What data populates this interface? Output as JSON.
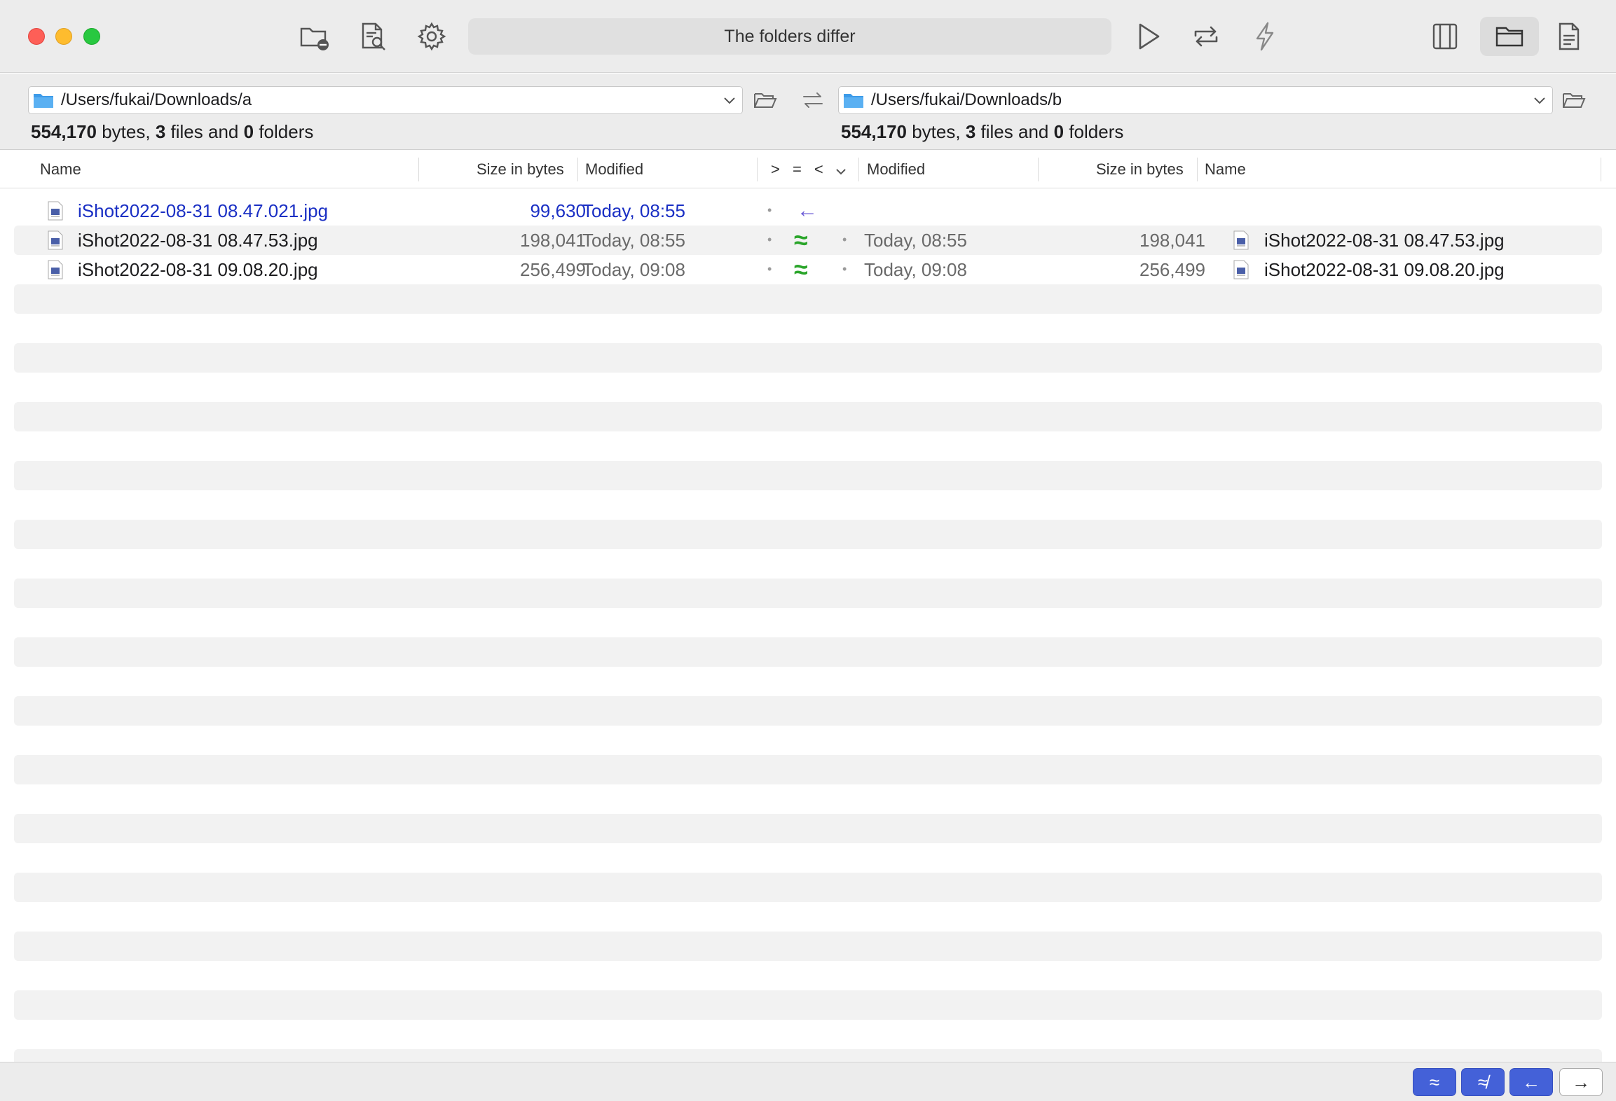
{
  "toolbar": {
    "status": "The folders differ",
    "left_icons": [
      "folder-minus-icon",
      "document-search-icon",
      "gear-icon"
    ],
    "right_icons": [
      "play-icon",
      "repeat-icon",
      "lightning-icon"
    ],
    "view_icons": [
      "sidebar-panel-icon",
      "folder-view-icon",
      "document-view-icon"
    ]
  },
  "left_pane": {
    "path": "/Users/fukai/Downloads/a",
    "summary": {
      "bytes": "554,170",
      "bytes_label": "bytes,",
      "files": "3",
      "files_label": "files and",
      "folders": "0",
      "folders_label": "folders"
    }
  },
  "right_pane": {
    "path": "/Users/fukai/Downloads/b",
    "summary": {
      "bytes": "554,170",
      "bytes_label": "bytes,",
      "files": "3",
      "files_label": "files and",
      "folders": "0",
      "folders_label": "folders"
    }
  },
  "columns": {
    "left_name": "Name",
    "left_size": "Size in bytes",
    "left_modified": "Modified",
    "compare": "> = <",
    "right_modified": "Modified",
    "right_size": "Size in bytes",
    "right_name": "Name"
  },
  "rows": [
    {
      "left_name": "iShot2022-08-31 08.47.021.jpg",
      "left_size": "99,630",
      "left_modified": "Today, 08:55",
      "compare_symbol": "←",
      "compare_state": "left-only",
      "right_name": "",
      "right_size": "",
      "right_modified": ""
    },
    {
      "left_name": "iShot2022-08-31 08.47.53.jpg",
      "left_size": "198,041",
      "left_modified": "Today, 08:55",
      "compare_symbol": "≈",
      "compare_state": "similar",
      "right_name": "iShot2022-08-31 08.47.53.jpg",
      "right_size": "198,041",
      "right_modified": "Today, 08:55"
    },
    {
      "left_name": "iShot2022-08-31 09.08.20.jpg",
      "left_size": "256,499",
      "left_modified": "Today, 09:08",
      "compare_symbol": "≈",
      "compare_state": "similar",
      "right_name": "iShot2022-08-31 09.08.20.jpg",
      "right_size": "256,499",
      "right_modified": "Today, 09:08"
    }
  ],
  "bottom_filters": [
    {
      "symbol": "≈",
      "state": "on"
    },
    {
      "symbol": "≉",
      "state": "on"
    },
    {
      "symbol": "←",
      "state": "on"
    },
    {
      "symbol": "→",
      "state": "off"
    }
  ],
  "colors": {
    "accent": "#4461d8",
    "left_only_text": "#1a2fc4",
    "similar_green": "#2aa52a",
    "arrow_purple": "#6b5bd6",
    "stripe": "#f2f2f2"
  }
}
